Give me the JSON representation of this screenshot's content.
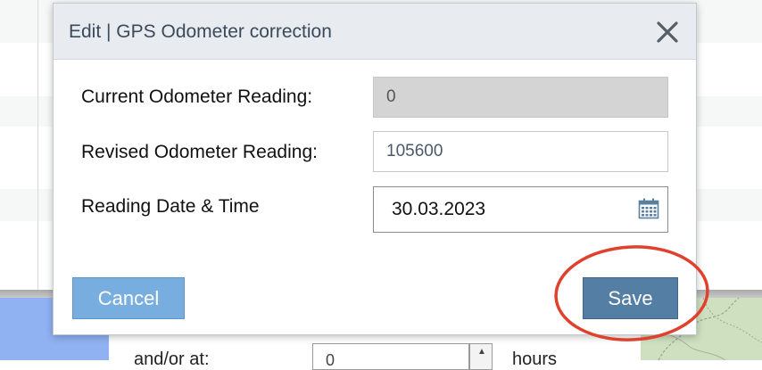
{
  "dialog": {
    "title": "Edit | GPS Odometer correction",
    "fields": [
      {
        "label": "Current Odometer Reading:",
        "value": "0",
        "readonly": true
      },
      {
        "label": "Revised Odometer Reading:",
        "value": "105600",
        "readonly": false
      },
      {
        "label": "Reading Date & Time",
        "value": "30.03.2023"
      }
    ],
    "buttons": {
      "cancel": "Cancel",
      "save": "Save"
    }
  },
  "background": {
    "label": "and/or at:",
    "input_value": "0",
    "unit": "hours"
  },
  "icons": {
    "close": "close-icon",
    "calendar": "calendar-icon",
    "spinner": "spinner-up-icon"
  },
  "colors": {
    "header_bg": "#e8ecf0",
    "cancel_button": "#77aedf",
    "save_button": "#547ea4",
    "annotation": "#e0412c",
    "readonly_input": "#d4d4d4"
  }
}
